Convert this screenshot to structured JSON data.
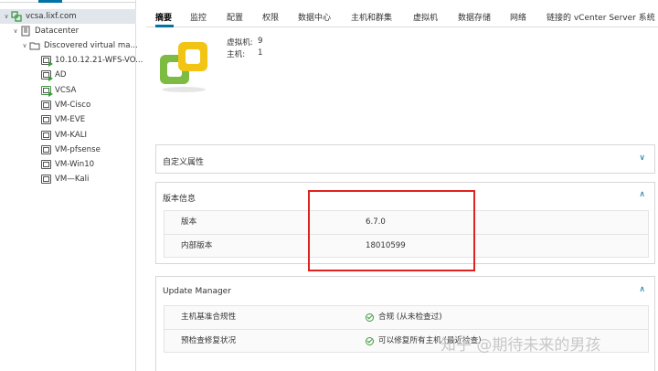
{
  "tree": {
    "root": "vcsa.lixf.com",
    "datacenter": "Datacenter",
    "folder": "Discovered virtual ma...",
    "vms": [
      "10.10.12.21-WFS-VO...",
      "AD",
      "VCSA",
      "VM-Cisco",
      "VM-EVE",
      "VM-KALI",
      "VM-pfsense",
      "VM-Win10",
      "VM—Kali"
    ]
  },
  "tabs": [
    "摘要",
    "监控",
    "配置",
    "权限",
    "数据中心",
    "主机和群集",
    "虚拟机",
    "数据存储",
    "网络",
    "链接的 vCenter Server 系统"
  ],
  "summary": {
    "vms_label": "虚拟机:",
    "vms_value": "9",
    "hosts_label": "主机:",
    "hosts_value": "1"
  },
  "panels": {
    "custom_attrs": {
      "title": "自定义属性"
    },
    "version": {
      "title": "版本信息",
      "rows": [
        {
          "key": "版本",
          "value": "6.7.0"
        },
        {
          "key": "内部版本",
          "value": "18010599"
        }
      ]
    },
    "update_manager": {
      "title": "Update Manager",
      "rows": [
        {
          "key": "主机基准合规性",
          "value": "合规 (从未检查过)"
        },
        {
          "key": "预检查修复状况",
          "value": "可以修复所有主机 (最近检查)"
        }
      ]
    }
  },
  "watermark": "知乎 @期待未来的男孩",
  "colors": {
    "accent": "#0072a3",
    "highlight": "#e0221f",
    "ok": "#3b9b3b",
    "logo_green": "#7dbb42",
    "logo_yellow": "#f2c515"
  }
}
